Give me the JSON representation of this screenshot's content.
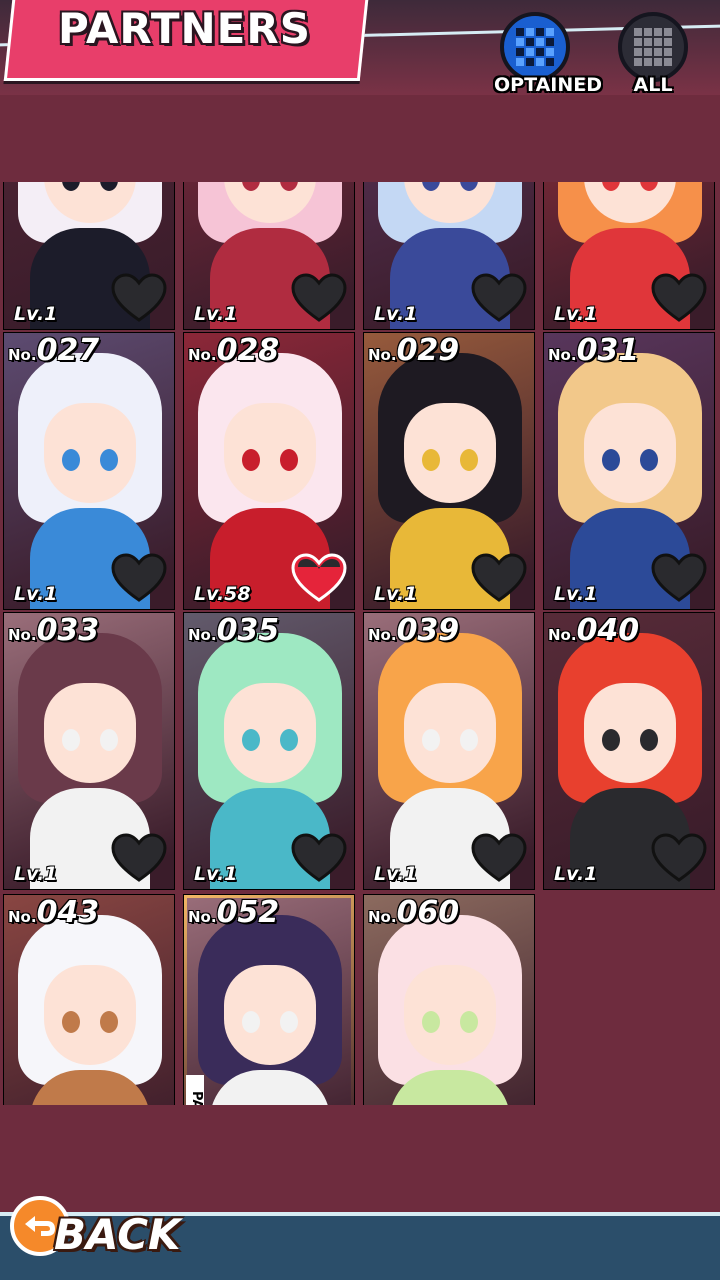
{
  "header": {
    "title": "PARTNERS"
  },
  "filters": [
    {
      "label": "OPTAINED",
      "icon": "grid-obtained-icon",
      "active": true
    },
    {
      "label": "ALL",
      "icon": "grid-all-icon",
      "active": false
    }
  ],
  "cards": [
    {
      "no_prefix": "",
      "no": "",
      "level": "Lv.1",
      "favorite": false,
      "hair": "#f4eef6",
      "accent": "#1c1c2a"
    },
    {
      "no_prefix": "",
      "no": "",
      "level": "Lv.1",
      "favorite": false,
      "hair": "#f6c4d6",
      "accent": "#b02c40"
    },
    {
      "no_prefix": "",
      "no": "",
      "level": "Lv.1",
      "favorite": false,
      "hair": "#c4d8f4",
      "accent": "#3a4a9a"
    },
    {
      "no_prefix": "",
      "no": "",
      "level": "Lv.1",
      "favorite": false,
      "hair": "#f6904a",
      "accent": "#e0363a"
    },
    {
      "no_prefix": "No.",
      "no": "027",
      "level": "Lv.1",
      "favorite": false,
      "hair": "#eef0fa",
      "accent": "#3a8ad8"
    },
    {
      "no_prefix": "No.",
      "no": "028",
      "level": "Lv.58",
      "favorite": true,
      "hair": "#fbe6ee",
      "accent": "#c81e2c"
    },
    {
      "no_prefix": "No.",
      "no": "029",
      "level": "Lv.1",
      "favorite": false,
      "hair": "#1e1a22",
      "accent": "#e8b838"
    },
    {
      "no_prefix": "No.",
      "no": "031",
      "level": "Lv.1",
      "favorite": false,
      "hair": "#f2c88a",
      "accent": "#2c4a98"
    },
    {
      "no_prefix": "No.",
      "no": "033",
      "level": "Lv.1",
      "favorite": false,
      "hair": "#6a3a4a",
      "accent": "#f2f2f2"
    },
    {
      "no_prefix": "No.",
      "no": "035",
      "level": "Lv.1",
      "favorite": false,
      "hair": "#9ee8c2",
      "accent": "#4ab8c8"
    },
    {
      "no_prefix": "No.",
      "no": "039",
      "level": "Lv.1",
      "favorite": false,
      "hair": "#f8a44a",
      "accent": "#f2f2f2"
    },
    {
      "no_prefix": "No.",
      "no": "040",
      "level": "Lv.1",
      "favorite": false,
      "hair": "#e8402e",
      "accent": "#2a2a2e"
    },
    {
      "no_prefix": "No.",
      "no": "043",
      "level": "",
      "favorite": false,
      "hair": "#f6f6fa",
      "accent": "#c07a4a"
    },
    {
      "no_prefix": "No.",
      "no": "052",
      "level": "",
      "favorite": false,
      "hair": "#3a2c5a",
      "accent": "#f2f2f2",
      "selected": true,
      "tag": "PAR"
    },
    {
      "no_prefix": "No.",
      "no": "060",
      "level": "",
      "favorite": false,
      "hair": "#fbe0e4",
      "accent": "#c8e8a0"
    }
  ],
  "footer": {
    "back_label": "BACK"
  }
}
